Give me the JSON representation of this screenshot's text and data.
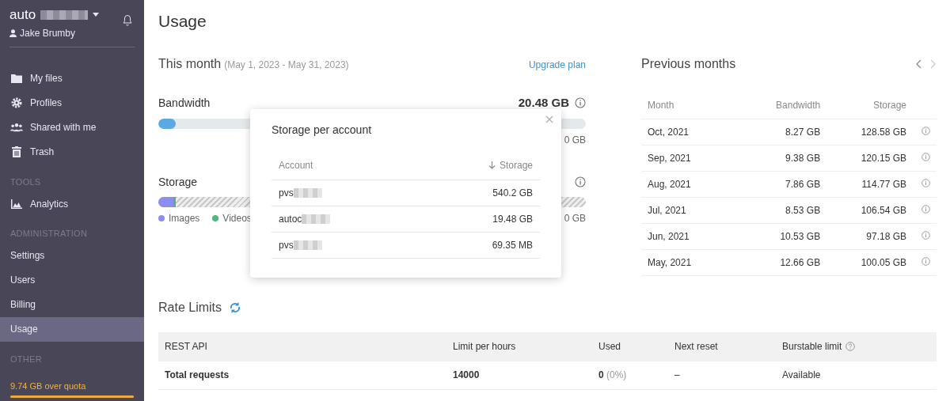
{
  "sidebar": {
    "account": "auto",
    "user": "Jake Brumby",
    "items": [
      {
        "label": "My files",
        "selected": false
      },
      {
        "label": "Profiles",
        "selected": false
      },
      {
        "label": "Shared with me",
        "selected": false
      },
      {
        "label": "Trash",
        "selected": false
      }
    ],
    "sections": [
      {
        "heading": "TOOLS",
        "items": [
          {
            "label": "Analytics",
            "selected": false
          }
        ]
      },
      {
        "heading": "ADMINISTRATION",
        "items": [
          {
            "label": "Settings",
            "selected": false
          },
          {
            "label": "Users",
            "selected": false
          },
          {
            "label": "Billing",
            "selected": false
          },
          {
            "label": "Usage",
            "selected": true
          }
        ]
      },
      {
        "heading": "OTHER"
      }
    ],
    "quota": {
      "text": "9.74 GB over quota",
      "level": 1
    }
  },
  "page_title": "Usage",
  "this_month": {
    "title": "This month",
    "range": "(May 1, 2023 - May 31, 2023)",
    "link": "Upgrade plan",
    "meters": [
      {
        "label": "Bandwidth",
        "value": "20.48 GB",
        "limit": "0 GB",
        "level": 0.04,
        "kind": "plain"
      },
      {
        "label": "Storage",
        "limit": "0 GB",
        "level": 0.035,
        "kind": "split",
        "legend": [
          {
            "label": "Images",
            "color": "#8b8ef0"
          },
          {
            "label": "Videos",
            "color": "#4cb87a"
          }
        ]
      }
    ]
  },
  "popover": {
    "title": "Storage per account",
    "columns": [
      "Account",
      "Storage"
    ],
    "rows": [
      {
        "account": "pvs",
        "storage": "540.2 GB"
      },
      {
        "account": "autoc",
        "storage": "19.48 GB"
      },
      {
        "account": "pvs",
        "storage": "69.35 MB"
      }
    ]
  },
  "previous_months": {
    "title": "Previous months",
    "columns": [
      "Month",
      "Bandwidth",
      "Storage"
    ],
    "rows": [
      [
        "Oct, 2021",
        "8.27 GB",
        "128.58 GB"
      ],
      [
        "Sep, 2021",
        "9.38 GB",
        "120.15 GB"
      ],
      [
        "Aug, 2021",
        "7.86 GB",
        "114.77 GB"
      ],
      [
        "Jul, 2021",
        "8.53 GB",
        "106.54 GB"
      ],
      [
        "Jun, 2021",
        "10.53 GB",
        "97.18 GB"
      ],
      [
        "May, 2021",
        "12.66 GB",
        "100.05 GB"
      ]
    ]
  },
  "rate_limits": {
    "title": "Rate Limits",
    "columns": [
      "REST API",
      "Limit per hours",
      "Used",
      "Next reset",
      "Burstable limit"
    ],
    "rows": [
      {
        "name": "Total requests",
        "limit": "14000",
        "used": "0",
        "used_pct": "(0%)",
        "reset": "–",
        "burstable": "Available"
      }
    ]
  }
}
